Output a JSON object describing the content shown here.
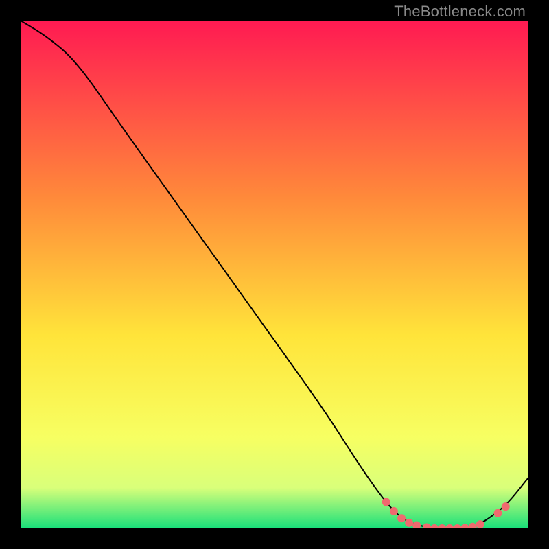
{
  "watermark": "TheBottleneck.com",
  "colors": {
    "bg": "#000000",
    "curve": "#000000",
    "marker_fill": "#ef6a6f",
    "marker_stroke": "#ef6a6f",
    "grad_top": "#ff1a52",
    "grad_mid_upper": "#ff8a3a",
    "grad_mid": "#ffe43a",
    "grad_low1": "#f7ff62",
    "grad_low2": "#d9ff7a",
    "grad_bottom": "#18e07a"
  },
  "chart_data": {
    "type": "line",
    "title": "",
    "xlabel": "",
    "ylabel": "",
    "xlim": [
      0,
      100
    ],
    "ylim": [
      0,
      100
    ],
    "curve": [
      {
        "x": 0,
        "y": 100
      },
      {
        "x": 5,
        "y": 97
      },
      {
        "x": 11,
        "y": 92
      },
      {
        "x": 20,
        "y": 79
      },
      {
        "x": 30,
        "y": 65
      },
      {
        "x": 40,
        "y": 51
      },
      {
        "x": 50,
        "y": 37
      },
      {
        "x": 60,
        "y": 23
      },
      {
        "x": 67,
        "y": 12
      },
      {
        "x": 72,
        "y": 5
      },
      {
        "x": 75,
        "y": 2
      },
      {
        "x": 78,
        "y": 0.6
      },
      {
        "x": 82,
        "y": 0
      },
      {
        "x": 86,
        "y": 0
      },
      {
        "x": 90,
        "y": 0.6
      },
      {
        "x": 93,
        "y": 2.5
      },
      {
        "x": 96,
        "y": 5
      },
      {
        "x": 100,
        "y": 10
      }
    ],
    "markers": [
      {
        "x": 72,
        "y": 5.2
      },
      {
        "x": 73.5,
        "y": 3.4
      },
      {
        "x": 75,
        "y": 2.0
      },
      {
        "x": 76.5,
        "y": 1.1
      },
      {
        "x": 78,
        "y": 0.6
      },
      {
        "x": 80,
        "y": 0.2
      },
      {
        "x": 81.5,
        "y": 0.0
      },
      {
        "x": 83,
        "y": 0.0
      },
      {
        "x": 84.5,
        "y": 0.0
      },
      {
        "x": 86,
        "y": 0.0
      },
      {
        "x": 87.5,
        "y": 0.1
      },
      {
        "x": 89,
        "y": 0.3
      },
      {
        "x": 90.5,
        "y": 0.8
      },
      {
        "x": 94,
        "y": 3.0
      },
      {
        "x": 95.5,
        "y": 4.3
      }
    ],
    "gradient_stops": [
      {
        "offset": 0.0,
        "key": "grad_top"
      },
      {
        "offset": 0.35,
        "key": "grad_mid_upper"
      },
      {
        "offset": 0.62,
        "key": "grad_mid"
      },
      {
        "offset": 0.82,
        "key": "grad_low1"
      },
      {
        "offset": 0.92,
        "key": "grad_low2"
      },
      {
        "offset": 1.0,
        "key": "grad_bottom"
      }
    ]
  }
}
